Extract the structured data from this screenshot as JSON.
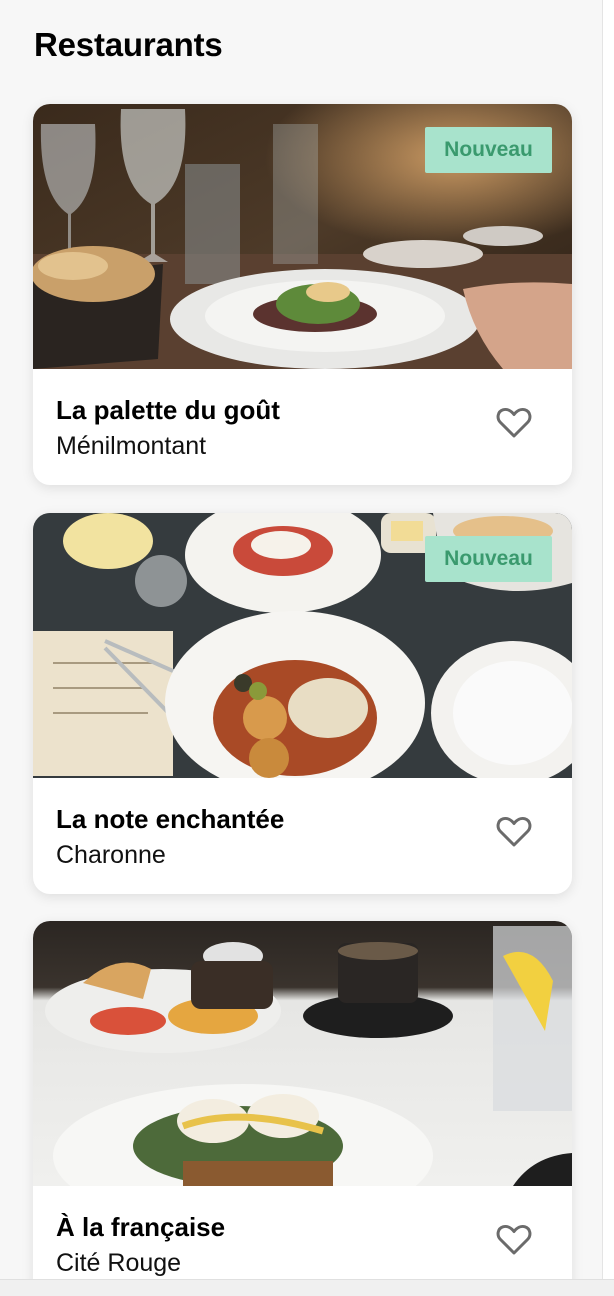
{
  "header": {
    "title": "Restaurants"
  },
  "restaurants": [
    {
      "name": "La palette du goût",
      "area": "Ménilmontant",
      "badge": "Nouveau",
      "photo": "plated-dish-on-dinner-table"
    },
    {
      "name": "La note enchantée",
      "area": "Charonne",
      "badge": "Nouveau",
      "photo": "overhead-table-with-dishes"
    },
    {
      "name": "À la française",
      "area": "Cité Rouge",
      "badge": "",
      "photo": "brunch-plates-on-white-table"
    }
  ],
  "icons": {
    "favorite": "heart-outline-icon"
  },
  "colors": {
    "badge_bg": "#a8e3cc",
    "badge_text": "#3a9a6e",
    "heart": "#6b6b6b"
  }
}
